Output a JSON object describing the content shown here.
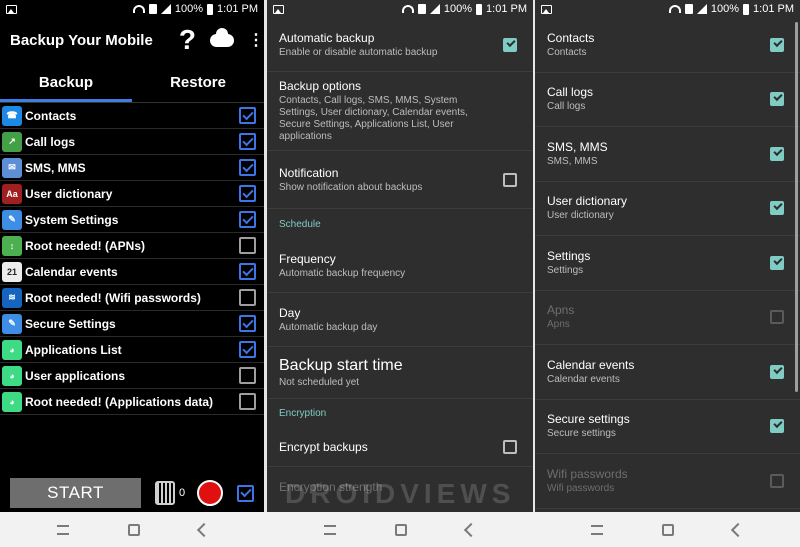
{
  "status_bar": {
    "battery": "100%",
    "time": "1:01 PM"
  },
  "backup_screen": {
    "title": "Backup Your Mobile",
    "icons": {
      "help": "?",
      "cloud": "cloud-icon",
      "more": "⋮"
    },
    "tabs": [
      {
        "label": "Backup",
        "active": true
      },
      {
        "label": "Restore",
        "active": false
      }
    ],
    "items": [
      {
        "label": "Contacts",
        "checked": true,
        "icon": "contacts-icon",
        "icon_color": "#1e88e5",
        "glyph": "☎"
      },
      {
        "label": "Call logs",
        "checked": true,
        "icon": "call-logs-icon",
        "icon_color": "#43a047",
        "glyph": "↗"
      },
      {
        "label": "SMS, MMS",
        "checked": true,
        "icon": "envelope-icon",
        "icon_color": "#5c8fd6",
        "glyph": "✉"
      },
      {
        "label": "User dictionary",
        "checked": true,
        "icon": "dictionary-icon",
        "icon_color": "#a02020",
        "glyph": "Aa"
      },
      {
        "label": "System Settings",
        "checked": true,
        "icon": "wrench-icon",
        "icon_color": "#3f8ee6",
        "glyph": "✎"
      },
      {
        "label": "Root needed! (APNs)",
        "checked": false,
        "icon": "apn-icon",
        "icon_color": "#4caf50",
        "glyph": "↕"
      },
      {
        "label": "Calendar events",
        "checked": true,
        "icon": "calendar-icon",
        "icon_color": "#ececec",
        "glyph": "21"
      },
      {
        "label": "Root needed! (Wifi passwords)",
        "checked": false,
        "icon": "wifi-icon",
        "icon_color": "#1565c0",
        "glyph": "≋"
      },
      {
        "label": "Secure Settings",
        "checked": true,
        "icon": "secure-wrench-icon",
        "icon_color": "#3f8ee6",
        "glyph": "✎"
      },
      {
        "label": "Applications List",
        "checked": true,
        "icon": "android-icon",
        "icon_color": "#3ddc84",
        "glyph": "◕"
      },
      {
        "label": "User applications",
        "checked": false,
        "icon": "android-icon",
        "icon_color": "#3ddc84",
        "glyph": "◕"
      },
      {
        "label": "Root needed! (Applications data)",
        "checked": false,
        "icon": "android-icon",
        "icon_color": "#3ddc84",
        "glyph": "◕"
      }
    ],
    "start_label": "START",
    "backup_count": "0",
    "footer_checked": true
  },
  "settings_screen": {
    "automatic_backup": {
      "title": "Automatic backup",
      "subtitle": "Enable or disable automatic backup",
      "checked": true
    },
    "backup_options": {
      "title": "Backup options",
      "subtitle": "Contacts, Call logs, SMS, MMS, System Settings, User dictionary, Calendar events, Secure Settings, Applications List, User applications"
    },
    "notification": {
      "title": "Notification",
      "subtitle": "Show notification about backups",
      "checked": false
    },
    "schedule_header": "Schedule",
    "frequency": {
      "title": "Frequency",
      "subtitle": "Automatic backup frequency"
    },
    "day": {
      "title": "Day",
      "subtitle": "Automatic backup day"
    },
    "start_time": {
      "title": "Backup start time",
      "subtitle": "Not scheduled yet"
    },
    "encryption_header": "Encryption",
    "encrypt": {
      "title": "Encrypt backups",
      "checked": false
    },
    "strength": {
      "title": "Encryption strength"
    },
    "watermark": "DROIDVIEWS"
  },
  "restore_options": [
    {
      "title": "Contacts",
      "subtitle": "Contacts",
      "checked": true,
      "enabled": true
    },
    {
      "title": "Call logs",
      "subtitle": "Call logs",
      "checked": true,
      "enabled": true
    },
    {
      "title": "SMS, MMS",
      "subtitle": "SMS, MMS",
      "checked": true,
      "enabled": true
    },
    {
      "title": "User dictionary",
      "subtitle": "User dictionary",
      "checked": true,
      "enabled": true
    },
    {
      "title": "Settings",
      "subtitle": "Settings",
      "checked": true,
      "enabled": true
    },
    {
      "title": "Apns",
      "subtitle": "Apns",
      "checked": false,
      "enabled": false
    },
    {
      "title": "Calendar events",
      "subtitle": "Calendar events",
      "checked": true,
      "enabled": true
    },
    {
      "title": "Secure settings",
      "subtitle": "Secure settings",
      "checked": true,
      "enabled": true
    },
    {
      "title": "Wifi passwords",
      "subtitle": "Wifi passwords",
      "checked": false,
      "enabled": false
    }
  ]
}
